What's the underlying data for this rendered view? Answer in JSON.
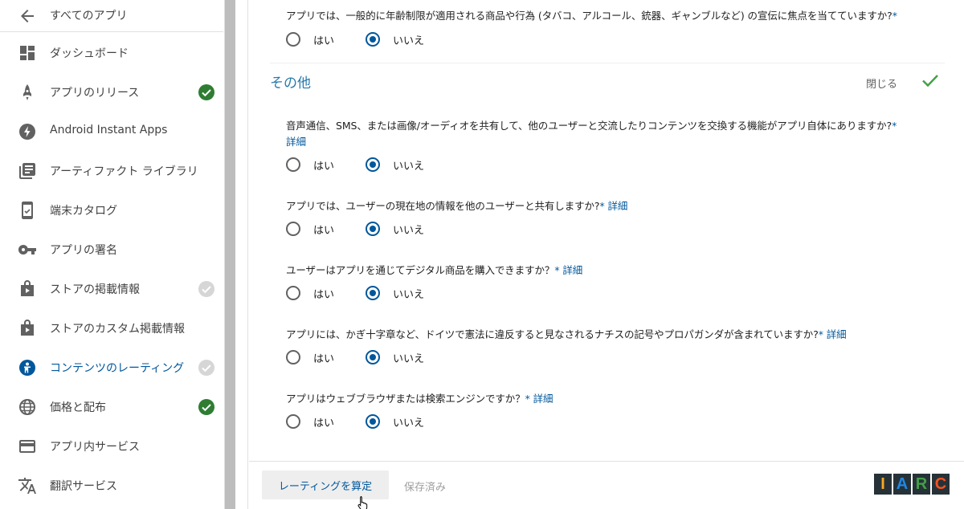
{
  "sidebar": {
    "back_label": "すべてのアプリ",
    "items": [
      {
        "label": "ダッシュボード",
        "icon": "dashboard-icon",
        "status": "none"
      },
      {
        "label": "アプリのリリース",
        "icon": "rocket-icon",
        "status": "complete"
      },
      {
        "label": "Android Instant Apps",
        "icon": "bolt-icon",
        "status": "none"
      },
      {
        "label": "アーティファクト ライブラリ",
        "icon": "library-icon",
        "status": "none"
      },
      {
        "label": "端末カタログ",
        "icon": "device-icon",
        "status": "none"
      },
      {
        "label": "アプリの署名",
        "icon": "key-icon",
        "status": "none"
      },
      {
        "label": "ストアの掲載情報",
        "icon": "store-icon",
        "status": "pending"
      },
      {
        "label": "ストアのカスタム掲載情報",
        "icon": "store-custom-icon",
        "status": "none"
      },
      {
        "label": "コンテンツのレーティング",
        "icon": "rating-icon",
        "status": "pending",
        "active": true
      },
      {
        "label": "価格と配布",
        "icon": "globe-icon",
        "status": "complete"
      },
      {
        "label": "アプリ内サービス",
        "icon": "card-icon",
        "status": "none"
      },
      {
        "label": "翻訳サービス",
        "icon": "translate-icon",
        "status": "none"
      }
    ]
  },
  "main": {
    "top_question": {
      "text": "アプリでは、一般的に年齢制限が適用される商品や行為 (タバコ、アルコール、銃器、ギャンブルなど) の宣伝に焦点を当てていますか?",
      "required_mark": "*",
      "answer": "no"
    },
    "section": {
      "title": "その他",
      "close_label": "閉じる"
    },
    "questions": [
      {
        "text": "音声通信、SMS、または画像/オーディオを共有して、他のユーザーと交流したりコンテンツを交換する機能がアプリ自体にありますか?",
        "required_mark": "*",
        "more": "詳細",
        "answer": "no"
      },
      {
        "text": "アプリでは、ユーザーの現在地の情報を他のユーザーと共有しますか?",
        "required_mark": "*",
        "more": "詳細",
        "answer": "no"
      },
      {
        "text": "ユーザーはアプリを通じてデジタル商品を購入できますか？",
        "required_mark": "*",
        "more": "詳細",
        "answer": "no"
      },
      {
        "text": "アプリには、かぎ十字章など、ドイツで憲法に違反すると見なされるナチスの記号やプロパガンダが含まれていますか?",
        "required_mark": "*",
        "more": "詳細",
        "answer": "no"
      },
      {
        "text": "アプリはウェブブラウザまたは検索エンジンですか？",
        "required_mark": "*",
        "more": "詳細",
        "answer": "no"
      }
    ],
    "yes_label": "はい",
    "no_label": "いいえ"
  },
  "bottom_bar": {
    "calc_button": "レーティングを算定",
    "saved_label": "保存済み",
    "iarc_letters": [
      "I",
      "A",
      "R",
      "C"
    ]
  },
  "colors": {
    "accent": "#01579b",
    "complete": "#2e7d32",
    "pending": "#bdbdbd",
    "iarc_i": "#f9a825",
    "iarc_a": "#1e88e5",
    "iarc_r": "#43a047",
    "iarc_c": "#f4511e",
    "iarc_bg": "#263238"
  }
}
